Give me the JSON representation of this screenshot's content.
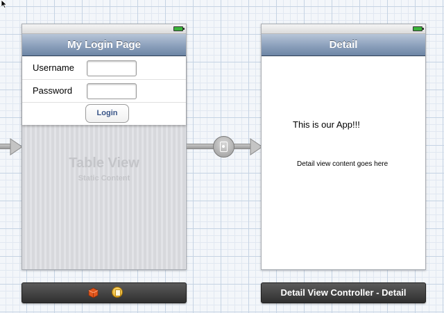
{
  "login_scene": {
    "nav_title": "My Login Page",
    "rows": [
      {
        "label": "Username",
        "value": ""
      },
      {
        "label": "Password",
        "value": ""
      }
    ],
    "login_button": "Login",
    "table_view_title": "Table View",
    "table_view_subtitle": "Static Content"
  },
  "detail_scene": {
    "nav_title": "Detail",
    "main_text": "This is our App!!!",
    "sub_text": "Detail view content goes here",
    "dock_title": "Detail View Controller - Detail"
  },
  "icons": {
    "battery": "battery-icon",
    "segue": "segue-icon",
    "first_responder": "cube-icon",
    "view_controller": "view-controller-icon",
    "cursor": "cursor-icon"
  },
  "colors": {
    "nav_bar": "#8fa3be",
    "button_text": "#385487",
    "dock": "#3a3a3a"
  }
}
